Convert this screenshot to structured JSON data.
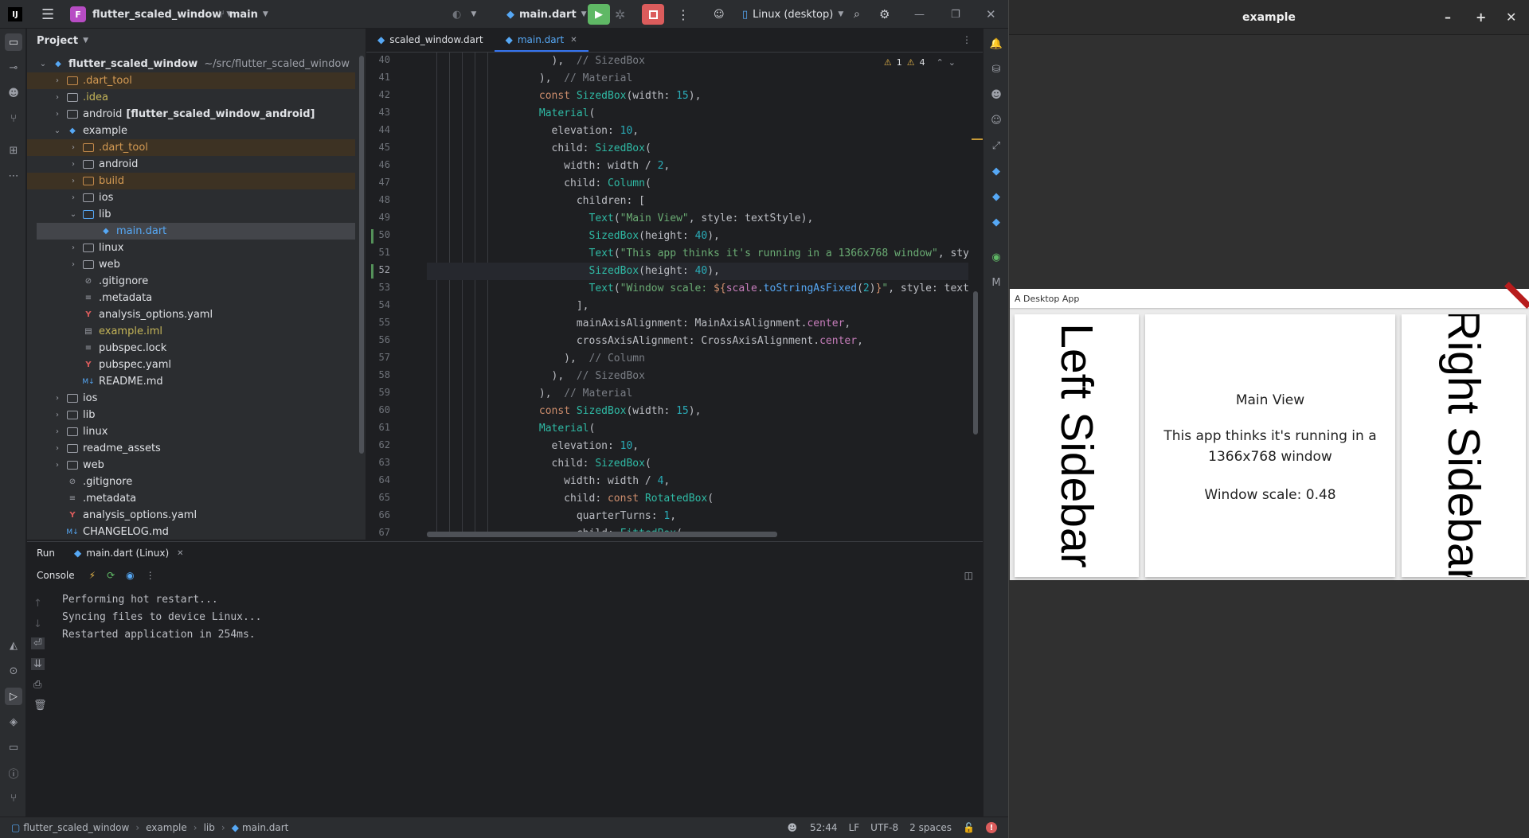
{
  "titlebar": {
    "logo": "IJ",
    "project_badge": "F",
    "project_name": "flutter_scaled_window",
    "branch": "main",
    "run_config": "main.dart",
    "device": "Linux (desktop)"
  },
  "project_panel": {
    "title": "Project",
    "root_name": "flutter_scaled_window",
    "root_path": "~/src/flutter_scaled_window",
    "items": [
      {
        "label": ".dart_tool"
      },
      {
        "label": ".idea"
      },
      {
        "label": "android",
        "suffix": "[flutter_scaled_window_android]"
      },
      {
        "label": "example"
      },
      {
        "label": ".dart_tool"
      },
      {
        "label": "android"
      },
      {
        "label": "build"
      },
      {
        "label": "ios"
      },
      {
        "label": "lib"
      },
      {
        "label": "main.dart"
      },
      {
        "label": "linux"
      },
      {
        "label": "web"
      },
      {
        "label": ".gitignore"
      },
      {
        "label": ".metadata"
      },
      {
        "label": "analysis_options.yaml"
      },
      {
        "label": "example.iml"
      },
      {
        "label": "pubspec.lock"
      },
      {
        "label": "pubspec.yaml"
      },
      {
        "label": "README.md"
      },
      {
        "label": "ios"
      },
      {
        "label": "lib"
      },
      {
        "label": "linux"
      },
      {
        "label": "readme_assets"
      },
      {
        "label": "web"
      },
      {
        "label": ".gitignore"
      },
      {
        "label": ".metadata"
      },
      {
        "label": "analysis_options.yaml"
      },
      {
        "label": "CHANGELOG.md"
      }
    ]
  },
  "editor": {
    "tabs": [
      {
        "label": "scaled_window.dart"
      },
      {
        "label": "main.dart"
      }
    ],
    "inspection": {
      "warnings": "1",
      "weak_warnings": "4"
    },
    "line_numbers": [
      "40",
      "41",
      "42",
      "43",
      "44",
      "45",
      "46",
      "47",
      "48",
      "49",
      "50",
      "51",
      "52",
      "53",
      "54",
      "55",
      "56",
      "57",
      "58",
      "59",
      "60",
      "61",
      "62",
      "63",
      "64",
      "65",
      "66",
      "67"
    ]
  },
  "run_panel": {
    "title": "Run",
    "tab_label": "main.dart (Linux)",
    "console_label": "Console",
    "output": [
      "Performing hot restart...",
      "Syncing files to device Linux...",
      "Restarted application in 254ms."
    ]
  },
  "statusbar": {
    "breadcrumbs": [
      "flutter_scaled_window",
      "example",
      "lib",
      "main.dart"
    ],
    "position": "52:44",
    "line_sep": "LF",
    "encoding": "UTF-8",
    "indent": "2 spaces"
  },
  "app": {
    "window_title": "example",
    "app_bar_title": "A Desktop App",
    "left_sidebar": "Left Sidebar",
    "right_sidebar": "Right Sidebar",
    "main_title": "Main View",
    "main_body": "This app thinks it's running in a 1366x768 window",
    "scale_text": "Window scale: 0.48"
  },
  "colors": {
    "ide_bg": "#1e1f22",
    "panel_bg": "#2b2d30",
    "accent": "#3574f0",
    "run_green": "#5fb865",
    "stop_red": "#db5c5c"
  }
}
